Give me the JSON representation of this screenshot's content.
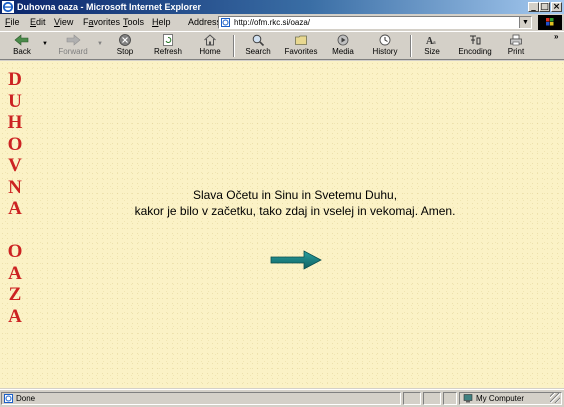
{
  "window": {
    "title": "Duhovna oaza - Microsoft Internet Explorer",
    "controls": {
      "minimize": "_",
      "maximize": "□",
      "close": "×"
    }
  },
  "menu": {
    "items": [
      {
        "label": "File",
        "underline": "F",
        "rest": "ile"
      },
      {
        "label": "Edit",
        "underline": "E",
        "rest": "dit"
      },
      {
        "label": "View",
        "underline": "V",
        "rest": "iew"
      },
      {
        "label": "Favorites",
        "underline": "a",
        "pre": "F",
        "rest": "vorites"
      },
      {
        "label": "Tools",
        "underline": "T",
        "rest": "ools"
      },
      {
        "label": "Help",
        "underline": "H",
        "rest": "elp"
      }
    ]
  },
  "address": {
    "label": "Address",
    "url": "http://ofm.rkc.si/oaza/"
  },
  "toolbar": {
    "back": "Back",
    "forward": "Forward",
    "stop": "Stop",
    "refresh": "Refresh",
    "home": "Home",
    "search": "Search",
    "favorites": "Favorites",
    "media": "Media",
    "history": "History",
    "size": "Size",
    "encoding": "Encoding",
    "print": "Print"
  },
  "page": {
    "vertical_title_letters": [
      "D",
      "U",
      "H",
      "O",
      "V",
      "N",
      "A",
      "",
      "O",
      "A",
      "Z",
      "A"
    ],
    "verse_line1": "Slava Očetu in Sinu in Svetemu Duhu,",
    "verse_line2": "kakor je bilo v začetku, tako zdaj in vselej in vekomaj. Amen.",
    "title_color": "#cc2222",
    "arrow_color": "#1a7f7f",
    "background_color": "#fbf2c6"
  },
  "status": {
    "text": "Done",
    "zone": "My Computer"
  }
}
